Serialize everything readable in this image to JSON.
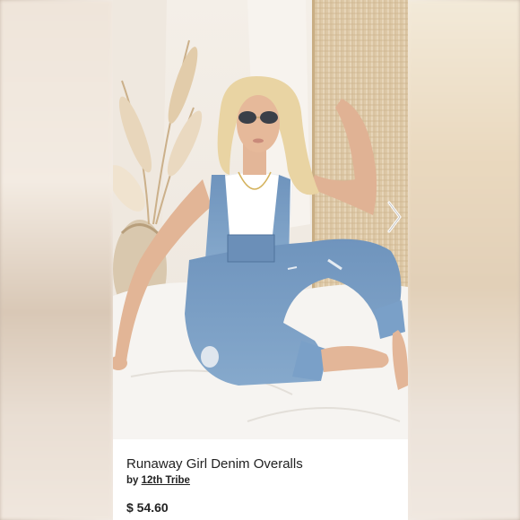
{
  "product": {
    "title": "Runaway Girl Denim Overalls",
    "by_prefix": "by",
    "brand": "12th Tribe",
    "price": "$ 54.60"
  },
  "gallery": {
    "next_icon": "chevron-right-icon"
  }
}
